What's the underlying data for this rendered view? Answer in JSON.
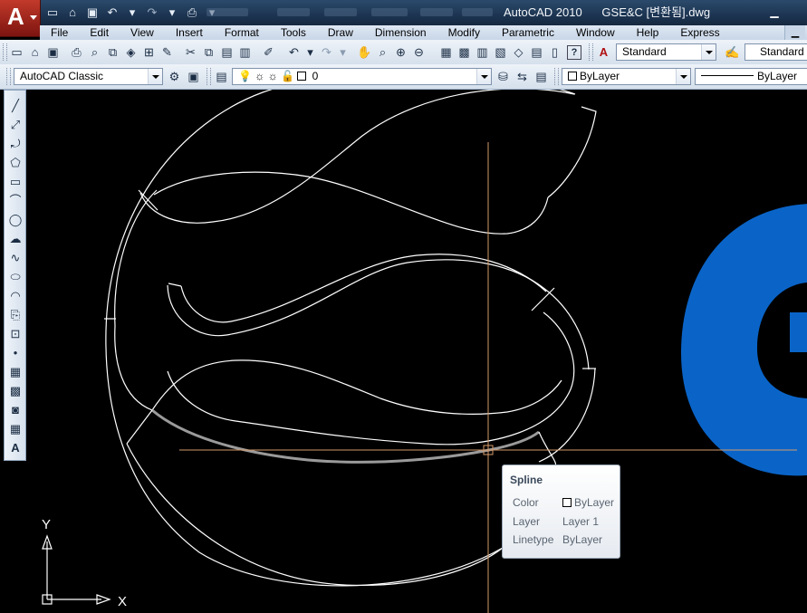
{
  "window": {
    "app_name": "AutoCAD 2010",
    "document": "GSE&C [변환됨].dwg",
    "app_button_letter": "A"
  },
  "menu": [
    "File",
    "Edit",
    "View",
    "Insert",
    "Format",
    "Tools",
    "Draw",
    "Dimension",
    "Modify",
    "Parametric",
    "Window",
    "Help",
    "Express"
  ],
  "toolbar": {
    "text_style": "Standard",
    "dim_style": "Standard",
    "workspace": "AutoCAD Classic",
    "layer": "0",
    "color": "ByLayer",
    "linetype": "ByLayer"
  },
  "tooltip": {
    "title": "Spline",
    "rows": [
      {
        "label": "Color",
        "value": "ByLayer"
      },
      {
        "label": "Layer",
        "value": "Layer 1"
      },
      {
        "label": "Linetype",
        "value": "ByLayer"
      }
    ]
  },
  "ucs": {
    "x_label": "X",
    "y_label": "Y"
  },
  "colors": {
    "canvas": "#000000",
    "crosshair": "#d49a6a",
    "geometry": "#ffffff",
    "logo_fill": "#0a64c8",
    "ribbon": "#1d3552"
  }
}
